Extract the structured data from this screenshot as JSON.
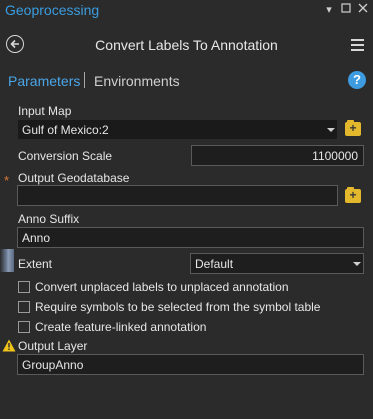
{
  "window": {
    "title": "Geoprocessing",
    "controls": [
      "pin-dropdown-icon",
      "restore-icon",
      "close-icon"
    ]
  },
  "header": {
    "tool_title": "Convert Labels To Annotation"
  },
  "tabs": {
    "parameters": "Parameters",
    "environments": "Environments",
    "help": "?"
  },
  "form": {
    "input_map": {
      "label": "Input Map",
      "value": "Gulf of Mexico:2"
    },
    "conversion_scale": {
      "label": "Conversion Scale",
      "value": "1100000"
    },
    "output_geodatabase": {
      "label": "Output Geodatabase",
      "value": "",
      "required": "*"
    },
    "anno_suffix": {
      "label": "Anno Suffix",
      "value": "Anno"
    },
    "extent": {
      "label": "Extent",
      "value": "Default"
    },
    "checkboxes": [
      {
        "label": "Convert unplaced labels to unplaced annotation",
        "checked": false
      },
      {
        "label": "Require symbols to be selected from the symbol table",
        "checked": false
      },
      {
        "label": "Create feature-linked annotation",
        "checked": false
      }
    ],
    "output_layer": {
      "label": "Output Layer",
      "value": "GroupAnno"
    }
  },
  "colors": {
    "accent": "#3a9de0",
    "background": "#2b2b2b",
    "field_bg": "#1e1e1e",
    "required": "#e07a3a",
    "warning": "#f0c419"
  }
}
